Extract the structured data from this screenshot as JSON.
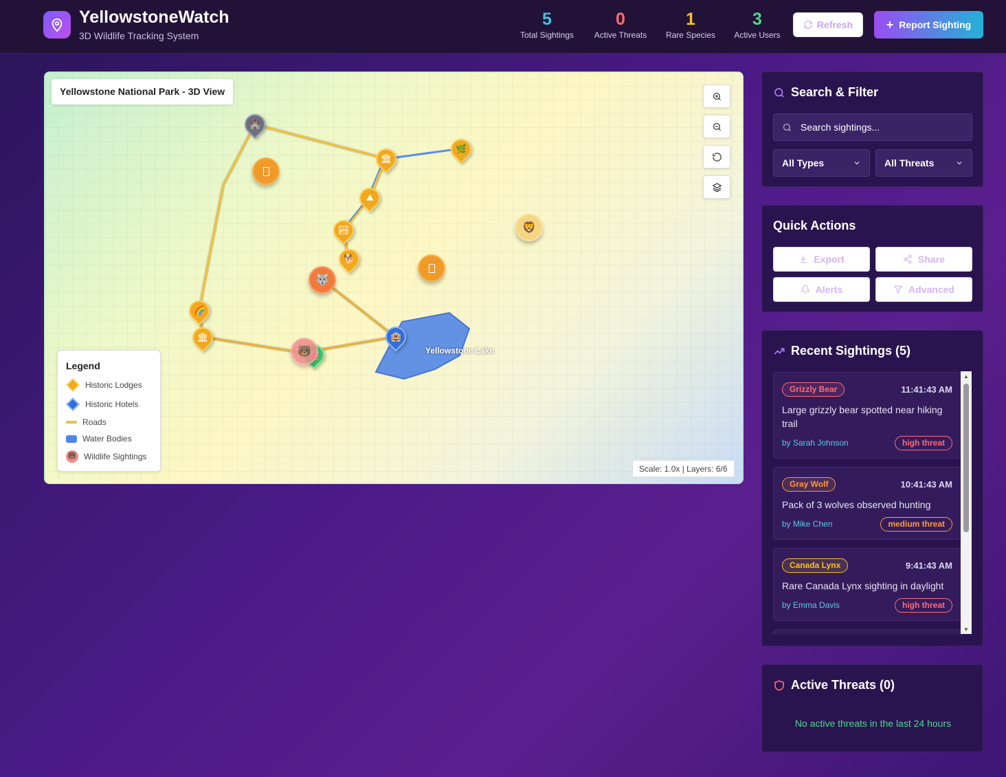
{
  "header": {
    "title": "YellowstoneWatch",
    "subtitle": "3D Wildlife Tracking System",
    "stats": [
      {
        "value": "5",
        "label": "Total Sightings",
        "color": "#3cc3e0"
      },
      {
        "value": "0",
        "label": "Active Threats",
        "color": "#ff6b6b"
      },
      {
        "value": "1",
        "label": "Rare Species",
        "color": "#f5c518"
      },
      {
        "value": "3",
        "label": "Active Users",
        "color": "#4cd98a"
      }
    ],
    "refresh_label": "Refresh",
    "report_label": "Report Sighting"
  },
  "map": {
    "title": "Yellowstone National Park - 3D View",
    "lake_label": "Yellowstone Lake",
    "scale_text": "Scale: 1.0x | Layers: 6/6",
    "controls": [
      "zoom-in-icon",
      "zoom-out-icon",
      "reset-icon",
      "layers-icon"
    ],
    "legend": {
      "title": "Legend",
      "items": [
        "Historic Lodges",
        "Historic Hotels",
        "Roads",
        "Water Bodies",
        "Wildlife Sightings"
      ]
    },
    "landmark_icons": [
      "🏰",
      "🏛",
      "🌿",
      "⛰",
      "🏞",
      "🐕",
      "🌈",
      "🏛",
      "🏨",
      "🏨"
    ],
    "wildlife_icons": [
      "🐺",
      "🐻",
      "🦁"
    ]
  },
  "search": {
    "title": "Search & Filter",
    "placeholder": "Search sightings...",
    "type_filter": "All Types",
    "threat_filter": "All Threats"
  },
  "quick_actions": {
    "title": "Quick Actions",
    "buttons": [
      "Export",
      "Share",
      "Alerts",
      "Advanced"
    ]
  },
  "recent": {
    "title": "Recent Sightings (5)",
    "items": [
      {
        "species": "Grizzly Bear",
        "species_color": "#ff6b7a",
        "time": "11:41:43 AM",
        "description": "Large grizzly bear spotted near hiking trail",
        "by": "by Sarah Johnson",
        "threat": "high threat",
        "threat_color": "#ff6b7a"
      },
      {
        "species": "Gray Wolf",
        "species_color": "#ff9a3c",
        "time": "10:41:43 AM",
        "description": "Pack of 3 wolves observed hunting",
        "by": "by Mike Chen",
        "threat": "medium threat",
        "threat_color": "#ff9a3c"
      },
      {
        "species": "Canada Lynx",
        "species_color": "#f5c518",
        "time": "9:41:43 AM",
        "description": "Rare Canada Lynx sighting in daylight",
        "by": "by Emma Davis",
        "threat": "high threat",
        "threat_color": "#ff6b7a"
      }
    ]
  },
  "threats": {
    "title": "Active Threats (0)",
    "empty_message": "No active threats in the last 24 hours"
  }
}
